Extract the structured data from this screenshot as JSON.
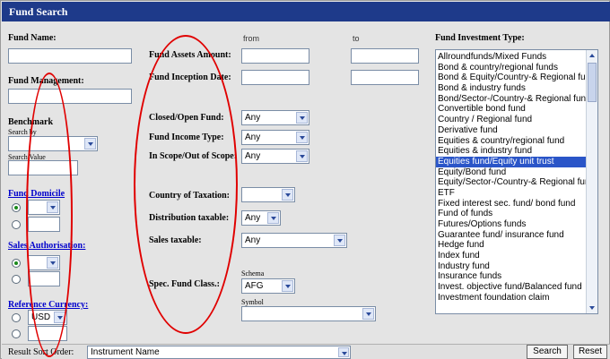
{
  "title": "Fund Search",
  "headers": {
    "from": "from",
    "to": "to"
  },
  "labels": {
    "fund_name": "Fund Name:",
    "fund_management": "Fund Management:",
    "benchmark": "Benchmark",
    "search_by": "Search by",
    "search_value": "Search Value",
    "fund_domicile": "Fund Domicile",
    "sales_authorisation": "Sales Authorisation:",
    "reference_currency": "Reference Currency:",
    "fund_assets_amount": "Fund Assets Amount:",
    "fund_inception_date": "Fund Inception Date:",
    "closed_open_fund": "Closed/Open Fund:",
    "fund_income_type": "Fund Income Type:",
    "in_scope_out_of_scope": "In Scope/Out of Scope:",
    "country_of_taxation": "Country of Taxation:",
    "distribution_taxable": "Distribution taxable:",
    "sales_taxable": "Sales taxable:",
    "spec_fund_class": "Spec. Fund Class.:",
    "schema": "Schema",
    "symbol": "Symbol",
    "fund_investment_type": "Fund Investment Type:",
    "result_sort_order": "Result Sort Order:"
  },
  "selects": {
    "closed_open_fund": "Any",
    "fund_income_type": "Any",
    "in_scope": "Any",
    "distribution_taxable": "Any",
    "sales_taxable": "Any",
    "schema": "AFG",
    "reference_currency": "USD",
    "sort_order": "Instrument Name"
  },
  "investment_types": [
    "Allroundfunds/Mixed Funds",
    "Bond & country/regional funds",
    "Bond & Equity/Country-& Regional fund",
    "Bond & industry funds",
    "Bond/Sector-/Country-& Regional fund",
    "Convertible bond fund",
    "Country / Regional fund",
    "Derivative fund",
    "Equities & country/regional fund",
    "Equities & industry fund",
    "Equities fund/Equity unit trust",
    "Equity/Bond fund",
    "Equity/Sector-/Country-& Regional fund",
    "ETF",
    "Fixed interest sec. fund/ bond fund",
    "Fund of funds",
    "Futures/Options funds",
    "Guarantee fund/ insurance fund",
    "Hedge fund",
    "Index fund",
    "Industry fund",
    "Insurance funds",
    "Invest. objective fund/Balanced fund",
    "Investment foundation claim"
  ],
  "selected_investment_type_index": 10,
  "buttons": {
    "search": "Search",
    "reset": "Reset"
  },
  "colors": {
    "title_bar": "#1e3a8a",
    "selection": "#2a55c8",
    "annotation": "#e00000",
    "link": "#0000cc"
  }
}
